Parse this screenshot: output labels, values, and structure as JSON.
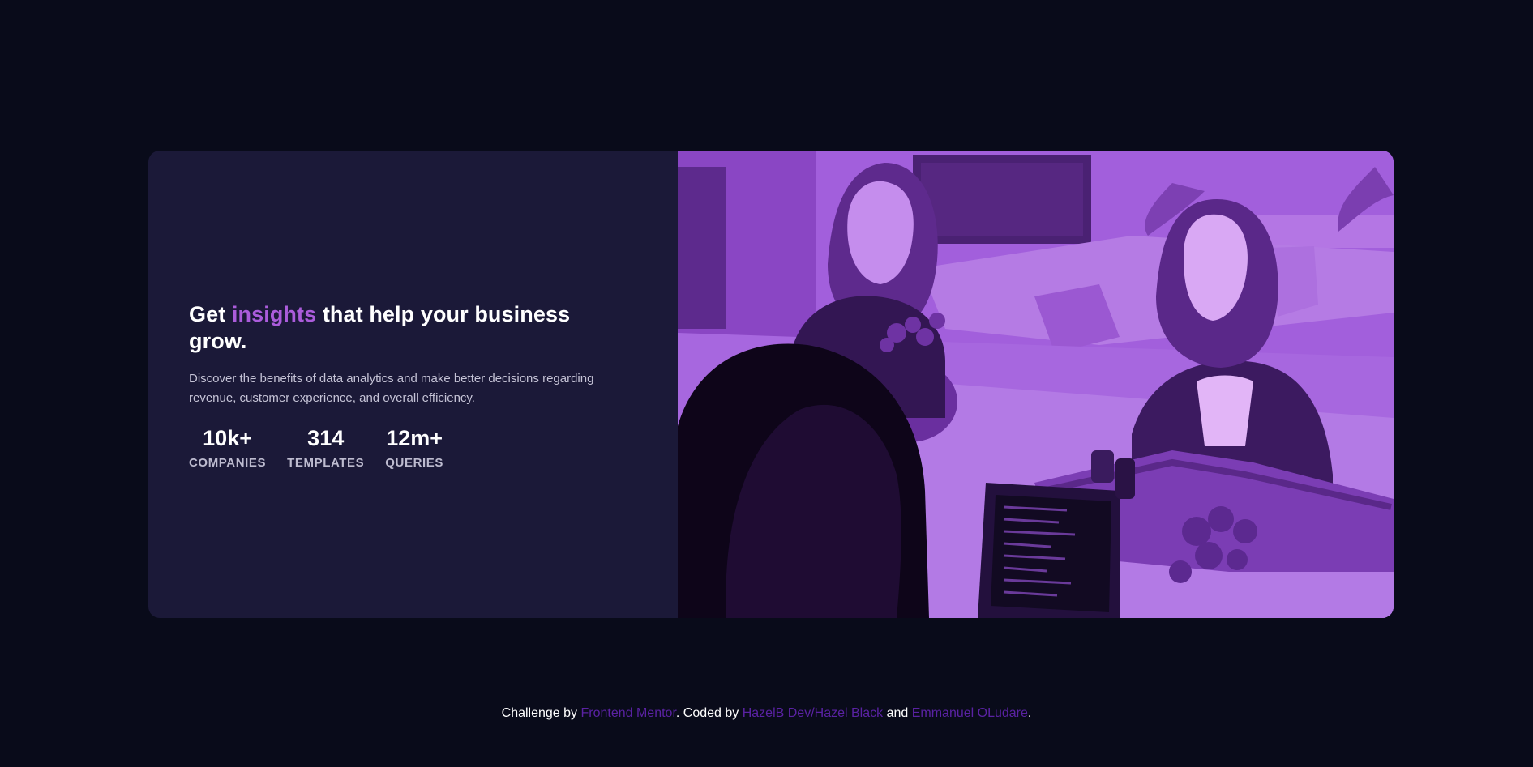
{
  "card": {
    "headline": {
      "prefix": "Get ",
      "accent": "insights",
      "suffix": " that help your business grow."
    },
    "description": "Discover the benefits of data analytics and make better decisions regarding revenue, customer experience, and overall efficiency.",
    "stats": [
      {
        "value": "10k+",
        "label": "COMPANIES"
      },
      {
        "value": "314",
        "label": "TEMPLATES"
      },
      {
        "value": "12m+",
        "label": "QUERIES"
      }
    ]
  },
  "footer": {
    "text_1": "Challenge by ",
    "link_1": "Frontend Mentor",
    "text_2": ". Coded by ",
    "link_2": "HazelB Dev/Hazel Black",
    "text_3": " and ",
    "link_3": "Emmanuel OLudare",
    "text_4": "."
  },
  "colors": {
    "page_background": "#090b1a",
    "card_background": "#1b1938",
    "accent": "#ab5cdb",
    "image_tint": "#a463dc",
    "footer_link": "#5a22a3"
  }
}
